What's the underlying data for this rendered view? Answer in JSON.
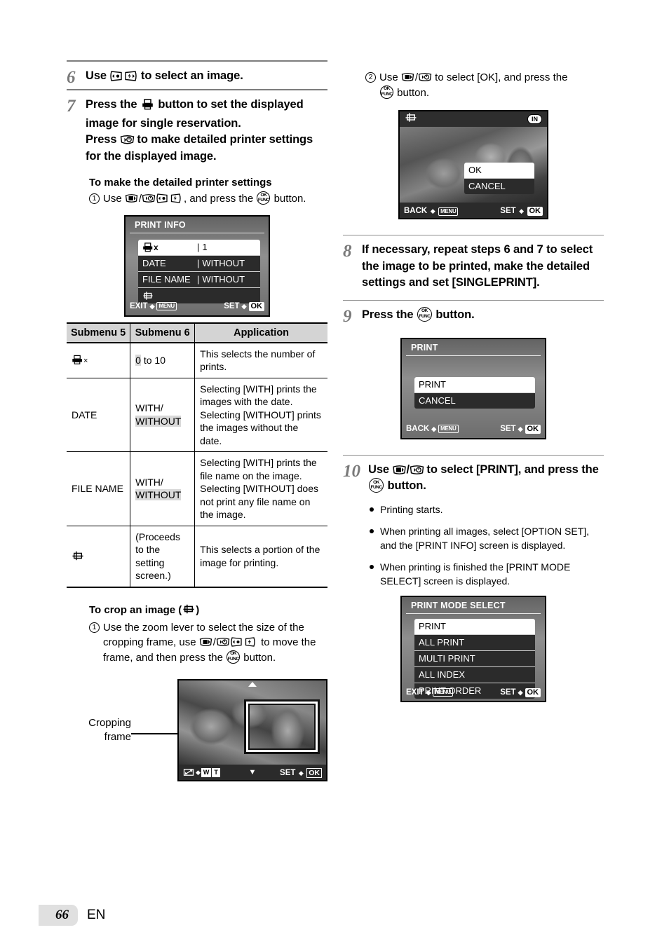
{
  "page": {
    "number": "66",
    "language": "EN"
  },
  "left_column": {
    "step6": {
      "num": "6",
      "text_before": "Use ",
      "icons": "macro-left / flash-right",
      "text_after": " to select an image."
    },
    "step7": {
      "num": "7",
      "line1_a": "Press the ",
      "line1_b": " button to set the displayed image for single reservation.",
      "line2_a": "Press ",
      "line2_b": " to make detailed printer settings for the displayed image."
    },
    "detailed_settings_heading": "To make the detailed printer settings",
    "detailed_settings_step": {
      "marker": "1",
      "text_a": "Use ",
      "text_b": ", and press the ",
      "text_c": " button."
    },
    "print_info_screen": {
      "title": "PRINT INFO",
      "rows": [
        {
          "label": "printer-x-icon",
          "value": "1",
          "selected": true
        },
        {
          "label": "DATE",
          "value": "WITHOUT",
          "selected": false
        },
        {
          "label": "FILE NAME",
          "value": "WITHOUT",
          "selected": false
        },
        {
          "label": "crop-icon",
          "value": "",
          "selected": false
        }
      ],
      "footer_left_label": "EXIT",
      "footer_left_key": "MENU",
      "footer_right_label": "SET",
      "footer_right_key": "OK"
    },
    "table": {
      "headers": [
        "Submenu 5",
        "Submenu 6",
        "Application"
      ],
      "rows": [
        {
          "submenu5": "printer-x-icon",
          "submenu5_is_icon": true,
          "submenu6_parts": [
            {
              "text": "0",
              "highlight": true
            },
            {
              "text": " to 10",
              "highlight": false
            }
          ],
          "application": "This selects the number of prints."
        },
        {
          "submenu5": "DATE",
          "submenu5_is_icon": false,
          "submenu6_parts": [
            {
              "text": "WITH/",
              "highlight": false
            },
            {
              "text": "WITHOUT",
              "highlight": true
            }
          ],
          "application": "Selecting [WITH] prints the images with the date. Selecting [WITHOUT] prints the images without the date."
        },
        {
          "submenu5": "FILE NAME",
          "submenu5_is_icon": false,
          "submenu6_parts": [
            {
              "text": "WITH/",
              "highlight": false
            },
            {
              "text": "WITHOUT",
              "highlight": true
            }
          ],
          "application": "Selecting [WITH] prints the file name on the image. Selecting [WITHOUT] does not print any file name on the image."
        },
        {
          "submenu5": "crop-icon",
          "submenu5_is_icon": true,
          "submenu6_parts": [
            {
              "text": "(Proceeds to the setting screen.)",
              "highlight": false
            }
          ],
          "application": "This selects a portion of the image for printing."
        }
      ]
    },
    "crop_heading_a": "To crop an image (",
    "crop_heading_b": ")",
    "crop_step": {
      "marker": "1",
      "text_a": "Use the zoom lever to select the size of the cropping frame, use ",
      "text_b": " to move the frame, and then press the ",
      "text_c": " button."
    },
    "crop_screen": {
      "caption_line1": "Cropping",
      "caption_line2": "frame",
      "footer_left_key_w": "W",
      "footer_left_key_t": "T",
      "footer_right_label": "SET",
      "footer_right_key": "OK"
    }
  },
  "right_column": {
    "step2_ok": {
      "marker": "2",
      "text_a": "Use ",
      "text_b": " to select [OK], and press the ",
      "text_c": " button."
    },
    "ok_cancel_screen": {
      "badge": "IN",
      "options": [
        {
          "label": "OK",
          "selected": true
        },
        {
          "label": "CANCEL",
          "selected": false
        }
      ],
      "footer_left_label": "BACK",
      "footer_left_key": "MENU",
      "footer_right_label": "SET",
      "footer_right_key": "OK"
    },
    "step8": {
      "num": "8",
      "text": "If necessary, repeat steps 6 and 7 to select the image to be printed, make the detailed settings and set [SINGLEPRINT]."
    },
    "step9": {
      "num": "9",
      "text_a": "Press the ",
      "text_b": " button."
    },
    "print_screen": {
      "title": "PRINT",
      "options": [
        {
          "label": "PRINT",
          "selected": true
        },
        {
          "label": "CANCEL",
          "selected": false
        }
      ],
      "footer_left_label": "BACK",
      "footer_left_key": "MENU",
      "footer_right_label": "SET",
      "footer_right_key": "OK"
    },
    "step10": {
      "num": "10",
      "text_a": "Use ",
      "text_b": " to select [PRINT], and press the ",
      "text_c": " button."
    },
    "step10_bullets": [
      "Printing starts.",
      "When printing all images, select [OPTION SET], and the [PRINT INFO] screen is displayed.",
      "When printing is finished the [PRINT MODE SELECT] screen is displayed."
    ],
    "print_mode_select_screen": {
      "title": "PRINT MODE SELECT",
      "options": [
        {
          "label": "PRINT",
          "selected": true
        },
        {
          "label": "ALL PRINT",
          "selected": false
        },
        {
          "label": "MULTI PRINT",
          "selected": false
        },
        {
          "label": "ALL INDEX",
          "selected": false
        },
        {
          "label": "PRINT ORDER",
          "selected": false
        }
      ],
      "footer_left_label": "EXIT",
      "footer_left_key": "MENU",
      "footer_right_label": "SET",
      "footer_right_key": "OK"
    }
  }
}
